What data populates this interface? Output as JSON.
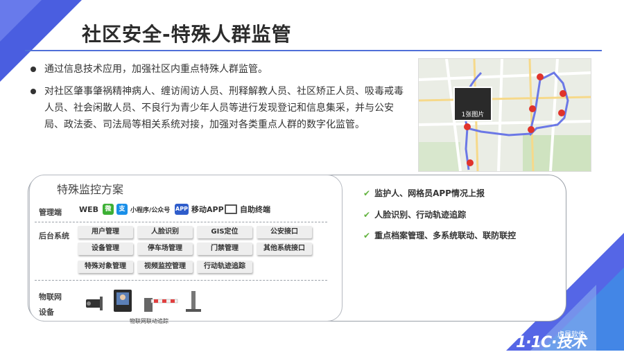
{
  "title": "社区安全-特殊人群监管",
  "bullets": [
    "通过信息技术应用，加强社区内重点特殊人群监管。",
    "对社区肇事肇祸精神病人、缠访闹访人员、刑释解教人员、社区矫正人员、吸毒戒毒人员、社会闲散人员、不良行为青少年人员等进行发现登记和信息集采，并与公安局、政法委、司法局等相关系统对接，加强对各类重点人群的数字化监管。"
  ],
  "map": {
    "thumb_label": "1张图片"
  },
  "panel": {
    "title": "特殊监控方案",
    "rows": {
      "terminal": "管理端",
      "backend": "后台系统",
      "iot_line1": "物联网",
      "iot_line2": "设备"
    },
    "channels": [
      "WEB",
      "小程序/公众号",
      "移动APP",
      "自助终端"
    ],
    "channel_icons": {
      "wechat": "微",
      "alipay": "支",
      "app": "APP"
    },
    "modules": [
      "用户管理",
      "人脸识别",
      "GIS定位",
      "公安接口",
      "设备管理",
      "停车场管理",
      "门禁管理",
      "其他系统接口",
      "特殊对象管理",
      "视频监控管理",
      "行动轨迹追踪"
    ],
    "device_caption": "物联网联动追踪"
  },
  "features": [
    "监护人、网格员APP情况上报",
    "人脸识别、行动轨迹追踪",
    "重点档案管理、多系统联动、联防联控"
  ],
  "logo": {
    "text": "1·1C·技术",
    "sub": "虎晨软件"
  },
  "colors": {
    "accent": "#4f6fd8",
    "check": "#63b33f",
    "corner": "#4a5ee0"
  }
}
